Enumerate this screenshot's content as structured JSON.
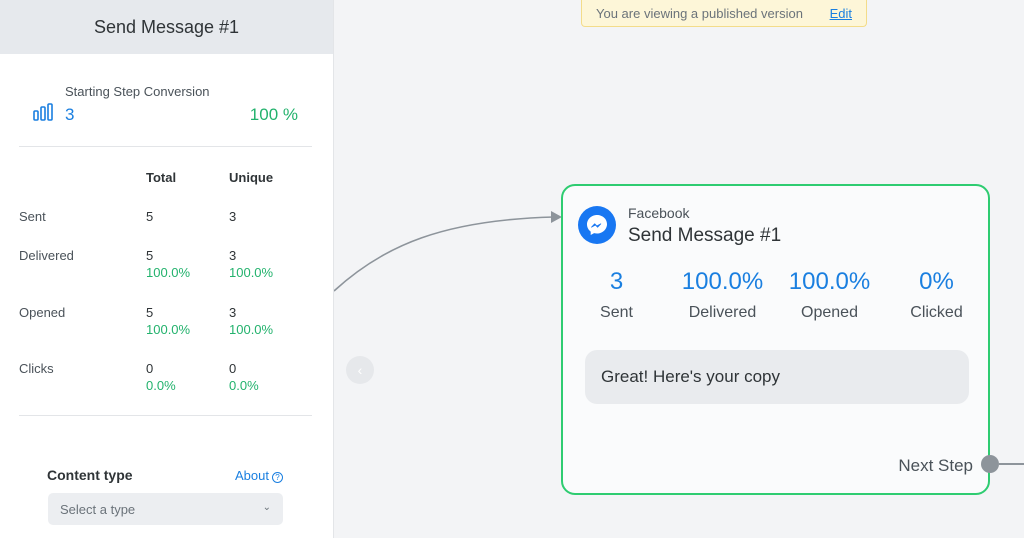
{
  "panel": {
    "title": "Send Message #1",
    "conversion": {
      "label": "Starting Step Conversion",
      "count": "3",
      "percent": "100 %"
    },
    "stats": {
      "headers": {
        "total": "Total",
        "unique": "Unique"
      },
      "rows": [
        {
          "label": "Sent",
          "total": "5",
          "unique": "3",
          "total_pct": "",
          "unique_pct": ""
        },
        {
          "label": "Delivered",
          "total": "5",
          "unique": "3",
          "total_pct": "100.0%",
          "unique_pct": "100.0%"
        },
        {
          "label": "Opened",
          "total": "5",
          "unique": "3",
          "total_pct": "100.0%",
          "unique_pct": "100.0%"
        },
        {
          "label": "Clicks",
          "total": "0",
          "unique": "0",
          "total_pct": "0.0%",
          "unique_pct": "0.0%"
        }
      ]
    },
    "content_type": {
      "label": "Content type",
      "about": "About",
      "help_glyph": "?",
      "select_placeholder": "Select a type",
      "chevron": "⌄"
    }
  },
  "banner": {
    "text": "You are viewing a published version",
    "edit": "Edit"
  },
  "collapse": {
    "glyph": "‹"
  },
  "node": {
    "platform": "Facebook",
    "title": "Send Message #1",
    "metrics": [
      {
        "value": "3",
        "label": "Sent"
      },
      {
        "value": "100.0%",
        "label": "Delivered"
      },
      {
        "value": "100.0%",
        "label": "Opened"
      },
      {
        "value": "0%",
        "label": "Clicked"
      }
    ],
    "message": "Great! Here's your copy",
    "next_step": "Next Step"
  },
  "icons": {
    "conversion": "bar-chart-icon",
    "platform": "messenger-icon",
    "help": "help-circle-icon",
    "collapse": "chevron-left-icon",
    "select": "chevron-down-icon"
  },
  "colors": {
    "accent": "#1a7fe0",
    "success": "#23b26d",
    "node_border": "#2ecc71",
    "messenger": "#1877f2"
  }
}
